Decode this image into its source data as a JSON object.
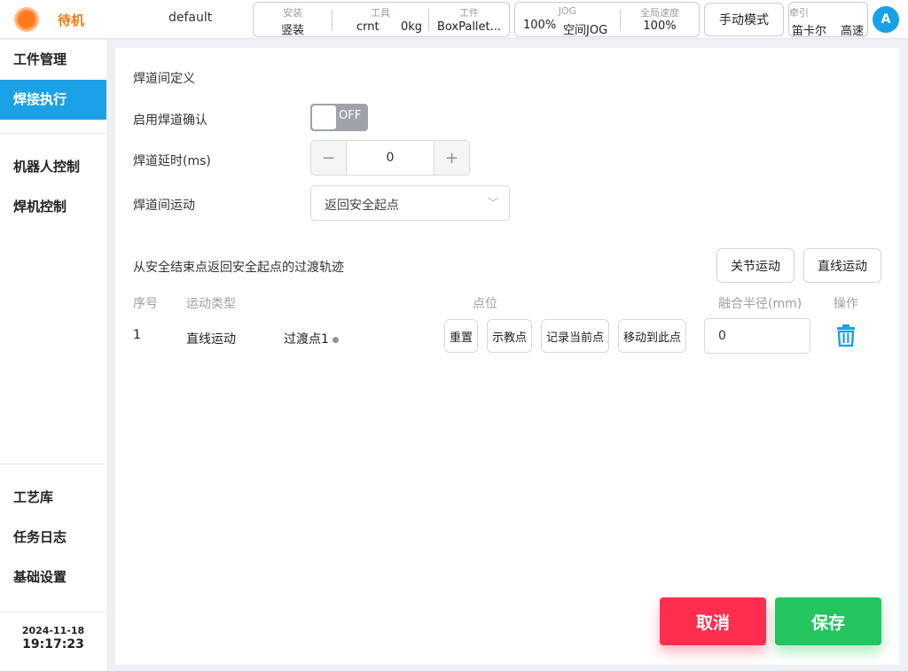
{
  "header": {
    "status": "待机",
    "project": "default",
    "install": {
      "caption": "安装",
      "value": "竖装"
    },
    "tool": {
      "caption": "工具",
      "name": "crnt",
      "load": "0kg"
    },
    "workpiece": {
      "caption": "工件",
      "value": "BoxPallet..."
    },
    "jog": {
      "caption": "JOG",
      "speed": "100%",
      "mode": "空间JOG"
    },
    "global_speed": {
      "caption": "全局速度",
      "value": "100%"
    },
    "mode_button": "手动模式",
    "traction": {
      "caption": "牵引",
      "coord": "笛卡尔",
      "speed": "高速"
    },
    "avatar": "A"
  },
  "sidebar": {
    "items": [
      {
        "label": "工件管理",
        "active": false
      },
      {
        "label": "焊接执行",
        "active": true
      },
      {
        "label": "机器人控制",
        "active": false
      },
      {
        "label": "焊机控制",
        "active": false
      },
      {
        "label": "工艺库",
        "active": false
      },
      {
        "label": "任务日志",
        "active": false
      },
      {
        "label": "基础设置",
        "active": false
      }
    ],
    "date": "2024-11-18",
    "time": "19:17:23"
  },
  "main": {
    "section_title": "焊道间定义",
    "confirm_label": "启用焊道确认",
    "confirm_toggle": "OFF",
    "delay_label": "焊道延时(ms)",
    "delay_value": "0",
    "motion_label": "焊道间运动",
    "motion_value": "返回安全起点",
    "trajectory_title": "从安全结束点返回安全起点的过渡轨迹",
    "joint_button": "关节运动",
    "linear_button": "直线运动",
    "table": {
      "headers": {
        "index": "序号",
        "motion_type": "运动类型",
        "point": "点位",
        "radius": "融合半径(mm)",
        "action": "操作"
      },
      "rows": [
        {
          "index": "1",
          "motion_type": "直线运动",
          "point": "过渡点1",
          "reset": "重置",
          "teach": "示教点",
          "record": "记录当前点",
          "move": "移动到此点",
          "radius": "0"
        }
      ]
    }
  },
  "footer": {
    "cancel": "取消",
    "save": "保存"
  },
  "colors": {
    "accent": "#1ba1e6",
    "status": "#f07b18",
    "cancel": "#ff2e4f",
    "save": "#22c55e"
  }
}
